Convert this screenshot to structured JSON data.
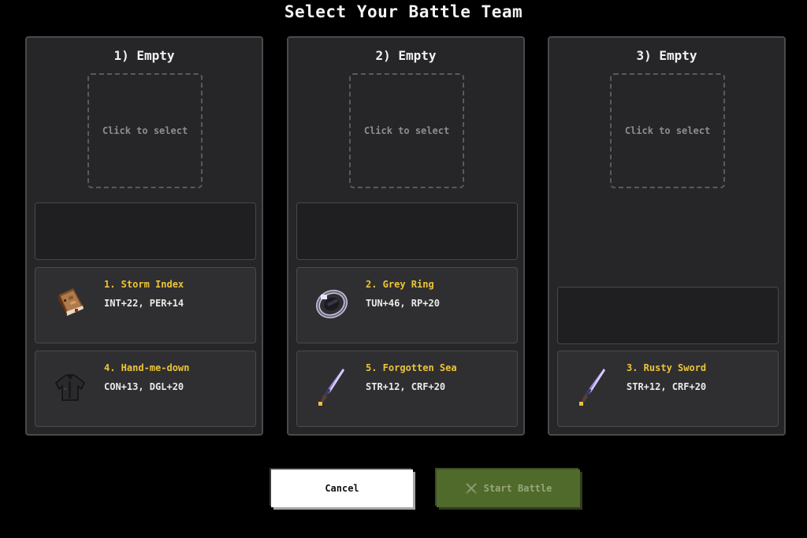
{
  "title": "Select Your Battle Team",
  "columns": [
    {
      "slot_title": "1) Empty",
      "placeholder": "Click to select",
      "items": [
        {
          "name": "1. Storm Index",
          "stats": "INT+22, PER+14",
          "icon": "book-icon"
        },
        {
          "name": "4. Hand-me-down",
          "stats": "CON+13, DGL+20",
          "icon": "shirt-icon"
        }
      ]
    },
    {
      "slot_title": "2) Empty",
      "placeholder": "Click to select",
      "items": [
        {
          "name": "2. Grey Ring",
          "stats": "TUN+46, RP+20",
          "icon": "ring-icon"
        },
        {
          "name": "5. Forgotten Sea",
          "stats": "STR+12, CRF+20",
          "icon": "sword-icon"
        }
      ]
    },
    {
      "slot_title": "3) Empty",
      "placeholder": "Click to select",
      "items": [
        {
          "name": "3. Rusty Sword",
          "stats": "STR+12, CRF+20",
          "icon": "sword-icon"
        }
      ]
    }
  ],
  "buttons": {
    "cancel": "Cancel",
    "start": "Start Battle",
    "start_icon": "crossed-swords-icon"
  },
  "colors": {
    "item_name": "#ecc43a",
    "start_button": "#4f6a2a"
  }
}
